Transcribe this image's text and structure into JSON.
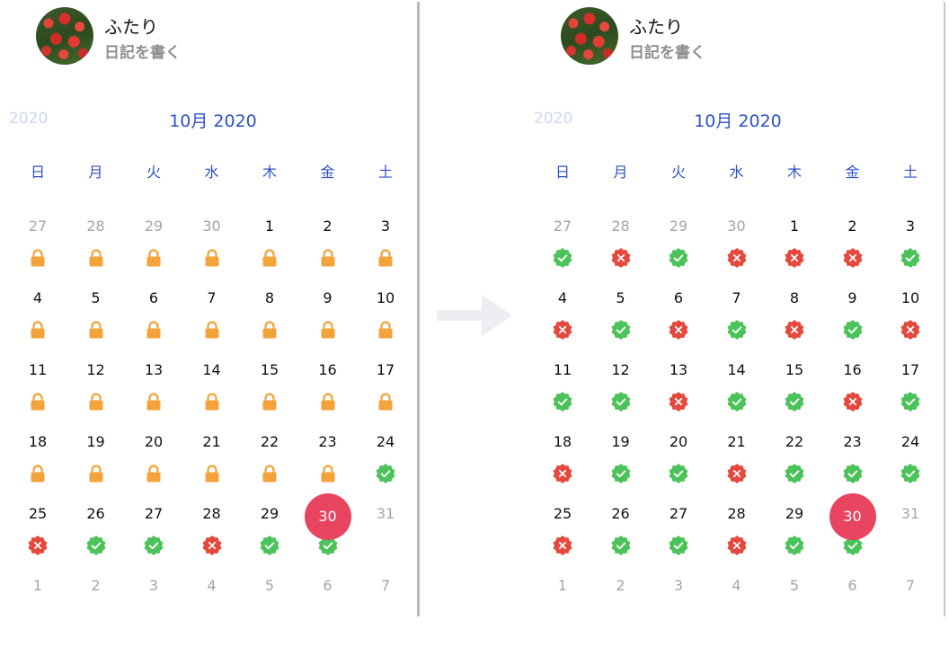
{
  "colors": {
    "accent_blue": "#2f50c8",
    "lock_orange": "#f3a33a",
    "ok_green": "#4cc35a",
    "ng_red": "#e5483c",
    "today_pink": "#e94560"
  },
  "left": {
    "profile": {
      "name": "ふたり",
      "subtitle": "日記を書く",
      "avatar": "red-tulips-photo"
    },
    "prev_year_label": "2020",
    "month_title": "10月 2020",
    "weekdays": [
      "日",
      "月",
      "火",
      "水",
      "木",
      "金",
      "土"
    ],
    "weeks": [
      [
        {
          "d": "27",
          "m": true,
          "s": "lock"
        },
        {
          "d": "28",
          "m": true,
          "s": "lock"
        },
        {
          "d": "29",
          "m": true,
          "s": "lock"
        },
        {
          "d": "30",
          "m": true,
          "s": "lock"
        },
        {
          "d": "1",
          "s": "lock"
        },
        {
          "d": "2",
          "s": "lock"
        },
        {
          "d": "3",
          "s": "lock"
        }
      ],
      [
        {
          "d": "4",
          "s": "lock"
        },
        {
          "d": "5",
          "s": "lock"
        },
        {
          "d": "6",
          "s": "lock"
        },
        {
          "d": "7",
          "s": "lock"
        },
        {
          "d": "8",
          "s": "lock"
        },
        {
          "d": "9",
          "s": "lock"
        },
        {
          "d": "10",
          "s": "lock"
        }
      ],
      [
        {
          "d": "11",
          "s": "lock"
        },
        {
          "d": "12",
          "s": "lock"
        },
        {
          "d": "13",
          "s": "lock"
        },
        {
          "d": "14",
          "s": "lock"
        },
        {
          "d": "15",
          "s": "lock"
        },
        {
          "d": "16",
          "s": "lock"
        },
        {
          "d": "17",
          "s": "lock"
        }
      ],
      [
        {
          "d": "18",
          "s": "lock"
        },
        {
          "d": "19",
          "s": "lock"
        },
        {
          "d": "20",
          "s": "lock"
        },
        {
          "d": "21",
          "s": "lock"
        },
        {
          "d": "22",
          "s": "lock"
        },
        {
          "d": "23",
          "s": "lock"
        },
        {
          "d": "24",
          "s": "ok"
        }
      ],
      [
        {
          "d": "25",
          "s": "ng"
        },
        {
          "d": "26",
          "s": "ok"
        },
        {
          "d": "27",
          "s": "ok"
        },
        {
          "d": "28",
          "s": "ng"
        },
        {
          "d": "29",
          "s": "ok"
        },
        {
          "d": "30",
          "today": true,
          "s": "ok"
        },
        {
          "d": "31",
          "m": true
        }
      ],
      [
        {
          "d": "1",
          "m": true
        },
        {
          "d": "2",
          "m": true
        },
        {
          "d": "3",
          "m": true
        },
        {
          "d": "4",
          "m": true
        },
        {
          "d": "5",
          "m": true
        },
        {
          "d": "6",
          "m": true
        },
        {
          "d": "7",
          "m": true
        }
      ]
    ]
  },
  "right": {
    "profile": {
      "name": "ふたり",
      "subtitle": "日記を書く",
      "avatar": "red-tulips-photo"
    },
    "prev_year_label": "2020",
    "month_title": "10月 2020",
    "weekdays": [
      "日",
      "月",
      "火",
      "水",
      "木",
      "金",
      "土"
    ],
    "weeks": [
      [
        {
          "d": "27",
          "m": true,
          "s": "ok"
        },
        {
          "d": "28",
          "m": true,
          "s": "ng"
        },
        {
          "d": "29",
          "m": true,
          "s": "ok"
        },
        {
          "d": "30",
          "m": true,
          "s": "ng"
        },
        {
          "d": "1",
          "s": "ng"
        },
        {
          "d": "2",
          "s": "ng"
        },
        {
          "d": "3",
          "s": "ok"
        }
      ],
      [
        {
          "d": "4",
          "s": "ng"
        },
        {
          "d": "5",
          "s": "ok"
        },
        {
          "d": "6",
          "s": "ng"
        },
        {
          "d": "7",
          "s": "ok"
        },
        {
          "d": "8",
          "s": "ng"
        },
        {
          "d": "9",
          "s": "ok"
        },
        {
          "d": "10",
          "s": "ng"
        }
      ],
      [
        {
          "d": "11",
          "s": "ok"
        },
        {
          "d": "12",
          "s": "ok"
        },
        {
          "d": "13",
          "s": "ng"
        },
        {
          "d": "14",
          "s": "ok"
        },
        {
          "d": "15",
          "s": "ok"
        },
        {
          "d": "16",
          "s": "ng"
        },
        {
          "d": "17",
          "s": "ok"
        }
      ],
      [
        {
          "d": "18",
          "s": "ng"
        },
        {
          "d": "19",
          "s": "ok"
        },
        {
          "d": "20",
          "s": "ok"
        },
        {
          "d": "21",
          "s": "ng"
        },
        {
          "d": "22",
          "s": "ok"
        },
        {
          "d": "23",
          "s": "ok"
        },
        {
          "d": "24",
          "s": "ok"
        }
      ],
      [
        {
          "d": "25",
          "s": "ng"
        },
        {
          "d": "26",
          "s": "ok"
        },
        {
          "d": "27",
          "s": "ok"
        },
        {
          "d": "28",
          "s": "ng"
        },
        {
          "d": "29",
          "s": "ok"
        },
        {
          "d": "30",
          "today": true,
          "s": "ok"
        },
        {
          "d": "31",
          "m": true
        }
      ],
      [
        {
          "d": "1",
          "m": true
        },
        {
          "d": "2",
          "m": true
        },
        {
          "d": "3",
          "m": true
        },
        {
          "d": "4",
          "m": true
        },
        {
          "d": "5",
          "m": true
        },
        {
          "d": "6",
          "m": true
        },
        {
          "d": "7",
          "m": true
        }
      ]
    ]
  },
  "transition_arrow_icon": "arrow-right-icon"
}
